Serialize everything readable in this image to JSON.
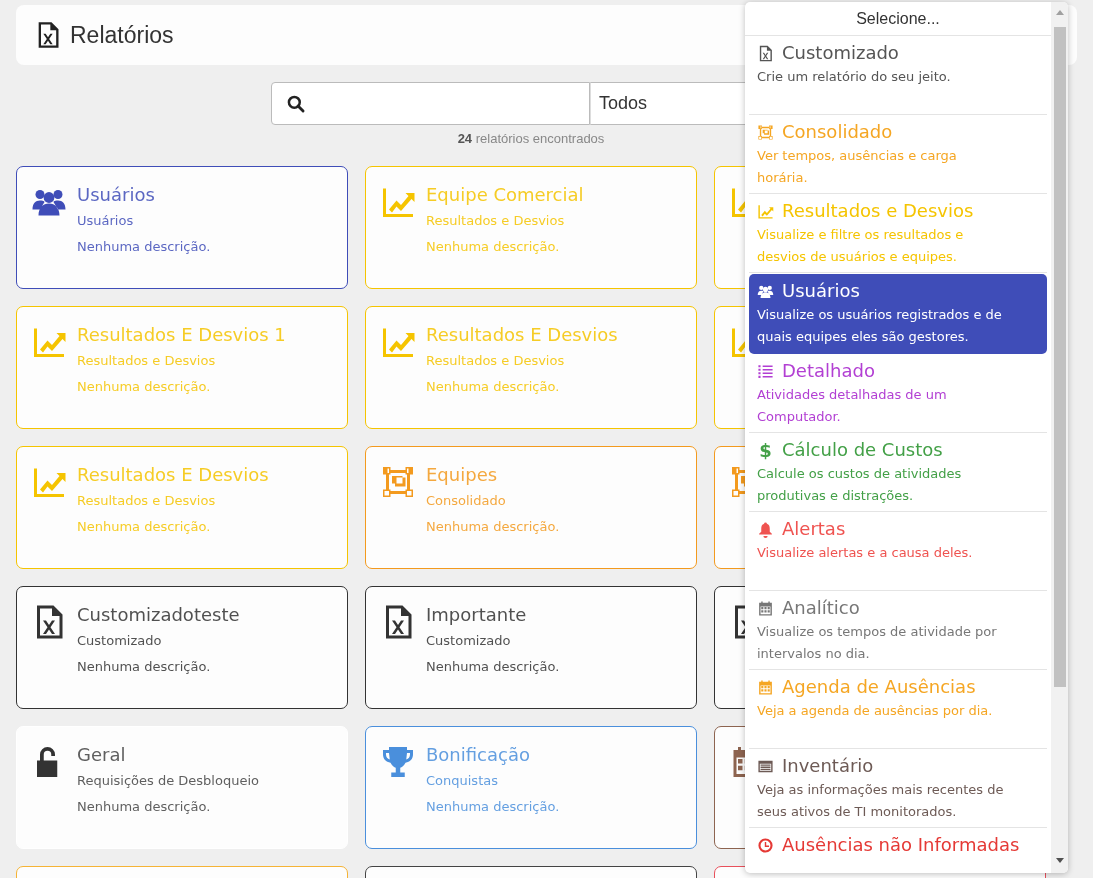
{
  "header": {
    "title": "Relatórios"
  },
  "search": {
    "filter": "Todos",
    "count": "**24** relatórios encontrados"
  },
  "cards": [
    {
      "kind": "users",
      "color": "#3f4db8",
      "title": "Usuários",
      "category": "Usuários",
      "description": "Nenhuma descrição."
    },
    {
      "kind": "chart",
      "color": "#f5c400",
      "title": "Equipe Comercial",
      "category": "Resultados e Desvios",
      "description": "Nenhuma descrição."
    },
    {
      "kind": "chart",
      "color": "#f5c400"
    },
    {
      "kind": "chart",
      "color": "#f5c400",
      "title": "Resultados E Desvios 1",
      "category": "Resultados e Desvios",
      "description": "Nenhuma descrição."
    },
    {
      "kind": "chart",
      "color": "#f5c400",
      "title": "Resultados E Desvios",
      "category": "Resultados e Desvios",
      "description": "Nenhuma descrição."
    },
    {
      "kind": "chart",
      "color": "#f5c400"
    },
    {
      "kind": "chart",
      "color": "#f5c400",
      "title": "Resultados E Desvios",
      "category": "Resultados e Desvios",
      "description": "Nenhuma descrição."
    },
    {
      "kind": "consolidated",
      "color": "#f39a1e",
      "title": "Equipes",
      "category": "Consolidado",
      "description": "Nenhuma descrição."
    },
    {
      "kind": "consolidated",
      "color": "#f39a1e"
    },
    {
      "kind": "file",
      "color": "#333333",
      "title": "Customizadoteste",
      "category": "Customizado",
      "description": "Nenhuma descrição."
    },
    {
      "kind": "file",
      "color": "#333333",
      "title": "Importante",
      "category": "Customizado",
      "description": "Nenhuma descrição."
    },
    {
      "kind": "file",
      "color": "#333333"
    },
    {
      "kind": "lock",
      "color": "#ffffff",
      "title": "Geral",
      "category": "Requisições de Desbloqueio",
      "description": "Nenhuma descrição."
    },
    {
      "kind": "trophy",
      "color": "#4a8fdc",
      "title": "Bonificação",
      "category": "Conquistas",
      "description": "Nenhuma descrição."
    },
    {
      "kind": "calendar",
      "color": "#8d6450"
    },
    {
      "kind": "blank",
      "color": "#f5b335"
    },
    {
      "kind": "blank",
      "color": "#444444"
    },
    {
      "kind": "blank",
      "color": "#e8505b"
    }
  ],
  "dropdown": {
    "placeholder": "Selecione...",
    "items": [
      {
        "kind": "file",
        "color": "#555555",
        "title": "Customizado",
        "description": "Crie um relatório do seu jeito.",
        "selected": false
      },
      {
        "kind": "consolidated",
        "color": "#f5a623",
        "title": "Consolidado",
        "description": "Ver tempos, ausências e carga horária.",
        "selected": false
      },
      {
        "kind": "chart",
        "color": "#f5c400",
        "title": "Resultados e Desvios",
        "description": "Visualize e filtre os resultados e desvios de usuários e equipes.",
        "selected": false
      },
      {
        "kind": "users",
        "color": "#3f4db8",
        "title": "Usuários",
        "description": "Visualize os usuários registrados e de quais equipes eles são gestores.",
        "selected": true
      },
      {
        "kind": "list",
        "color": "#b23fd3",
        "title": "Detalhado",
        "description": "Atividades detalhadas de um Computador.",
        "selected": false
      },
      {
        "kind": "symbol",
        "symbol": "$",
        "color": "#43a047",
        "title": "Cálculo de Custos",
        "description": "Calcule os custos de atividades produtivas e distrações.",
        "selected": false
      },
      {
        "kind": "bell",
        "color": "#ef5350",
        "title": "Alertas",
        "description": "Visualize alertas e a causa deles.",
        "selected": false
      },
      {
        "kind": "calendar",
        "color": "#777777",
        "title": "Analítico",
        "description": "Visualize os tempos de atividade por intervalos no dia.",
        "selected": false
      },
      {
        "kind": "calendar",
        "color": "#f5a623",
        "title": "Agenda de Ausências",
        "description": "Veja a agenda de ausências por dia.",
        "selected": false
      },
      {
        "kind": "inventory",
        "color": "#6d5a55",
        "title": "Inventário",
        "description": "Veja as informações mais recentes de seus ativos de TI monitorados.",
        "selected": false
      },
      {
        "kind": "clock",
        "color": "#e53935",
        "title": "Ausências não Informadas",
        "selected": false
      }
    ]
  }
}
